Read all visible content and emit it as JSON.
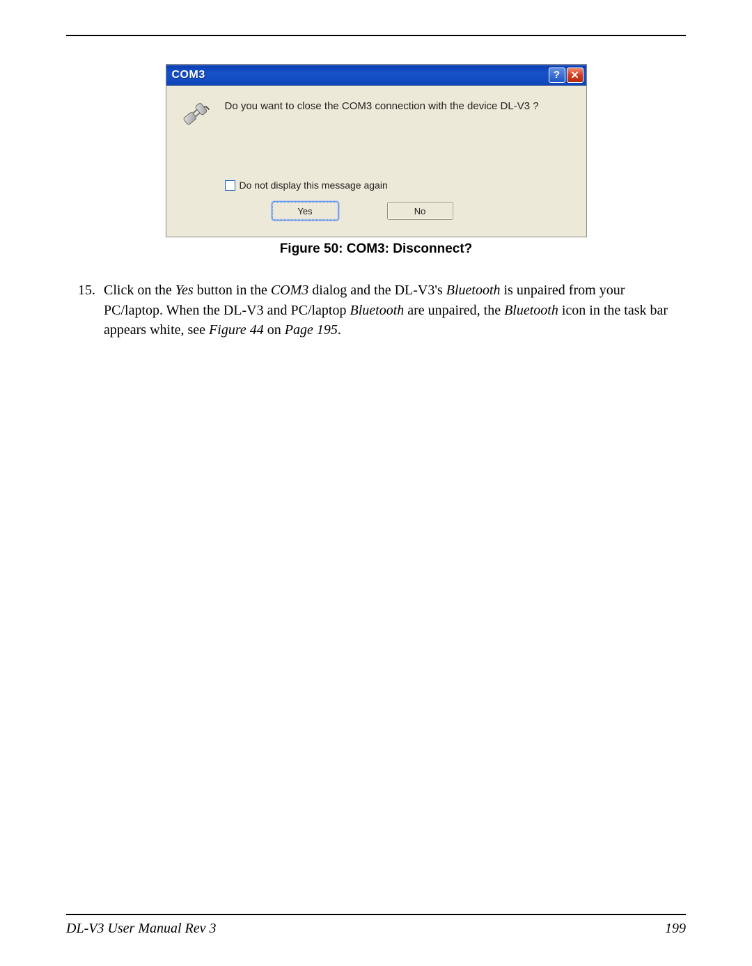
{
  "dialog": {
    "title": "COM3",
    "message": "Do you want to close the COM3 connection with the device DL-V3 ?",
    "checkbox_label": "Do not display this message again",
    "yes_label": "Yes",
    "no_label": "No"
  },
  "figure": {
    "caption": "Figure 50: COM3: Disconnect?"
  },
  "step": {
    "number": "15.",
    "t1": "Click on the ",
    "yes_it": "Yes",
    "t2": " button in the ",
    "com3_it": "COM3",
    "t3": " dialog and the DL-V3's ",
    "bt1_it": "Bluetooth",
    "t4": " is unpaired from your PC/laptop. When the DL-V3 and PC/laptop ",
    "bt2_it": "Bluetooth",
    "t5": " are unpaired, the ",
    "bt3_it": "Bluetooth",
    "t6": " icon in the task bar appears white, see ",
    "fig_it": "Figure 44",
    "t7": " on ",
    "page_it": "Page 195",
    "t8": "."
  },
  "footer": {
    "manual": "DL-V3 User Manual Rev 3",
    "page": "199"
  }
}
